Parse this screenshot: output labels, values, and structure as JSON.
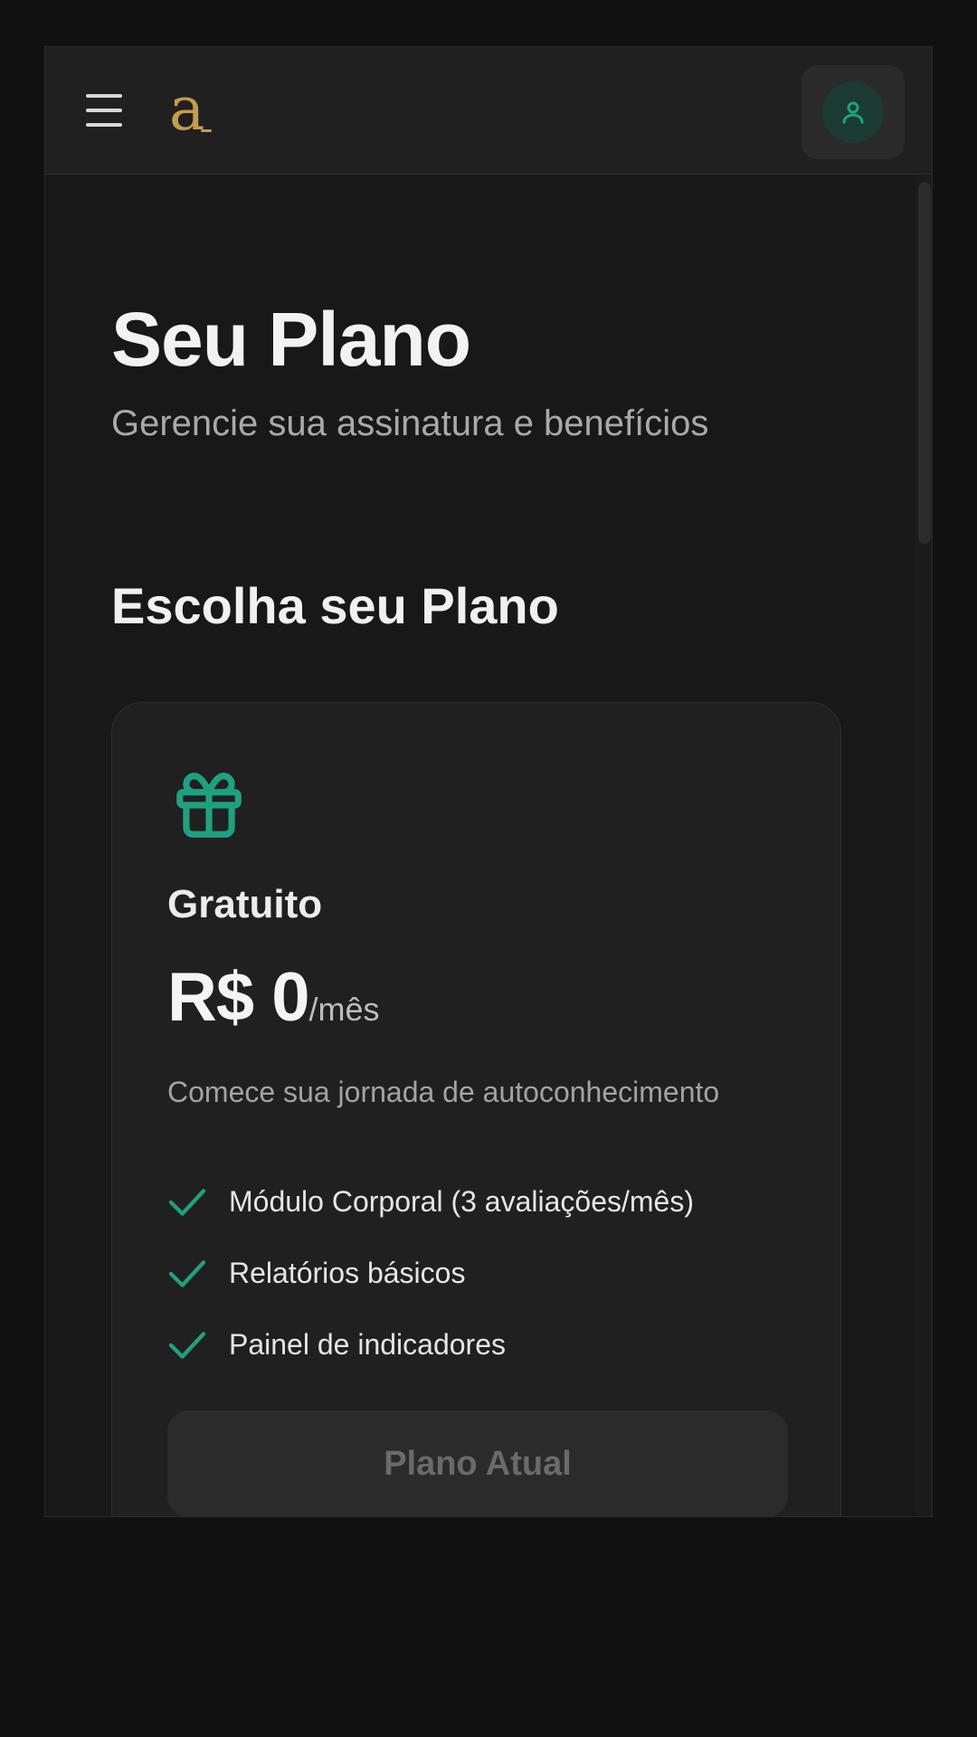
{
  "header": {
    "logo_text": "a",
    "menu_icon": "hamburger-menu-icon",
    "user_icon": "user-icon"
  },
  "page": {
    "title": "Seu Plano",
    "subtitle": "Gerencie sua assinatura e benefícios"
  },
  "plans_section": {
    "title": "Escolha seu Plano",
    "plans": [
      {
        "icon": "gift-icon",
        "name": "Gratuito",
        "price": "R$ 0",
        "period": "/mês",
        "description": "Comece sua jornada de autoconhecimento",
        "features": [
          "Módulo Corporal (3 avaliações/mês)",
          "Relatórios básicos",
          "Painel de indicadores"
        ],
        "button_label": "Plano Atual"
      }
    ]
  },
  "colors": {
    "accent": "#1fa17f",
    "brand": "#c69b4a",
    "background": "#111111",
    "card": "#202020"
  }
}
